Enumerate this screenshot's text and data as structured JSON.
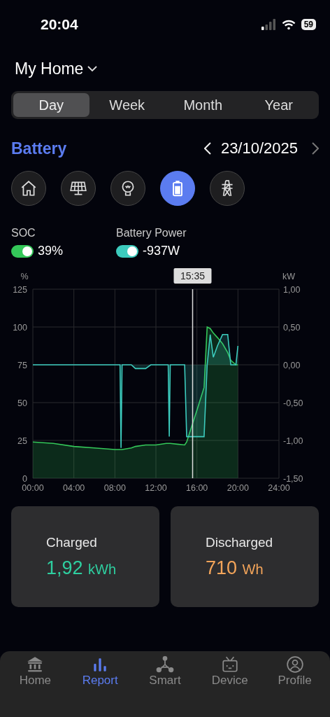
{
  "status_bar": {
    "time": "20:04",
    "battery": "59"
  },
  "header": {
    "title": "My Home"
  },
  "period_tabs": [
    {
      "label": "Day",
      "selected": true
    },
    {
      "label": "Week",
      "selected": false
    },
    {
      "label": "Month",
      "selected": false
    },
    {
      "label": "Year",
      "selected": false
    }
  ],
  "section": {
    "title": "Battery",
    "date": "23/10/2025"
  },
  "category_buttons": [
    {
      "kind": "home",
      "selected": false
    },
    {
      "kind": "solar",
      "selected": false
    },
    {
      "kind": "bulb",
      "selected": false
    },
    {
      "kind": "battery",
      "selected": true
    },
    {
      "kind": "pylon",
      "selected": false
    }
  ],
  "legend": [
    {
      "on": true,
      "value": "39%"
    },
    {
      "on": true,
      "value": "-937W"
    }
  ],
  "chart": {
    "chart_data": {
      "type": "area",
      "grid": true,
      "ref_lines": [
        {
          "axis": "x",
          "value": 15.58
        }
      ],
      "annotations": [
        {
          "x": 15.58,
          "y": 125,
          "text": "15:35"
        }
      ],
      "ylabel": "%",
      "y2label": "kW",
      "xlim": [
        0,
        24
      ],
      "ylim": [
        0,
        125
      ],
      "y2lim": [
        -1.5,
        1
      ],
      "xticks": [
        {
          "value": 0,
          "label": "00:00"
        },
        {
          "value": 4,
          "label": "04:00"
        },
        {
          "value": 8,
          "label": "08:00"
        },
        {
          "value": 12,
          "label": "12:00"
        },
        {
          "value": 16,
          "label": "16:00"
        },
        {
          "value": 20,
          "label": "20:00"
        },
        {
          "value": 24,
          "label": "24:00"
        }
      ],
      "yticks": [
        0,
        25,
        50,
        75,
        100,
        125
      ],
      "y2ticks": [
        {
          "value": 1,
          "label": "1,00"
        },
        {
          "value": 0.5,
          "label": "0,50"
        },
        {
          "value": 0,
          "label": "0,00"
        },
        {
          "value": -0.5,
          "label": "-0,50"
        },
        {
          "value": -1,
          "label": "-1,00"
        },
        {
          "value": -1.5,
          "label": "-1,50"
        }
      ],
      "x": [
        0,
        2,
        4,
        6,
        8,
        8.5,
        8.6,
        8.7,
        9.6,
        10,
        11,
        11.5,
        12,
        13,
        13.2,
        13.3,
        13.4,
        14.8,
        15,
        16,
        16.7,
        17,
        17.3,
        17.6,
        18,
        18.5,
        19,
        19.3,
        19.8,
        20
      ],
      "series": [
        {
          "name": "SOC",
          "color": "#34c759",
          "values": [
            24,
            23,
            21,
            20,
            19,
            19,
            19,
            19,
            20,
            21,
            22,
            22,
            22,
            23,
            23,
            23,
            23,
            22,
            24,
            45,
            60,
            100,
            99,
            96,
            93,
            89,
            83,
            78,
            75,
            75
          ]
        },
        {
          "name": "Battery Power",
          "color": "#3ccbbd",
          "axis": "y2",
          "values": [
            0,
            0,
            0,
            0,
            0,
            0,
            -1.1,
            0,
            0,
            -0.05,
            -0.05,
            0,
            0,
            0,
            0,
            -0.95,
            0,
            0,
            -0.95,
            -0.95,
            -0.95,
            0,
            0.4,
            0.1,
            0.25,
            0.4,
            0.4,
            0,
            0,
            0.25
          ]
        }
      ]
    }
  },
  "stats": [
    {
      "label": "Charged",
      "value": "1,92",
      "unit": "kWh",
      "color": "#2ecfa0"
    },
    {
      "label": "Discharged",
      "value": "710",
      "unit": "Wh",
      "color": "#f4a55a"
    }
  ],
  "nav": [
    {
      "kind": "home",
      "label": "Home",
      "selected": false
    },
    {
      "kind": "report",
      "label": "Report",
      "selected": true
    },
    {
      "kind": "smart",
      "label": "Smart",
      "selected": false
    },
    {
      "kind": "device",
      "label": "Device",
      "selected": false
    },
    {
      "kind": "profile",
      "label": "Profile",
      "selected": false
    }
  ]
}
